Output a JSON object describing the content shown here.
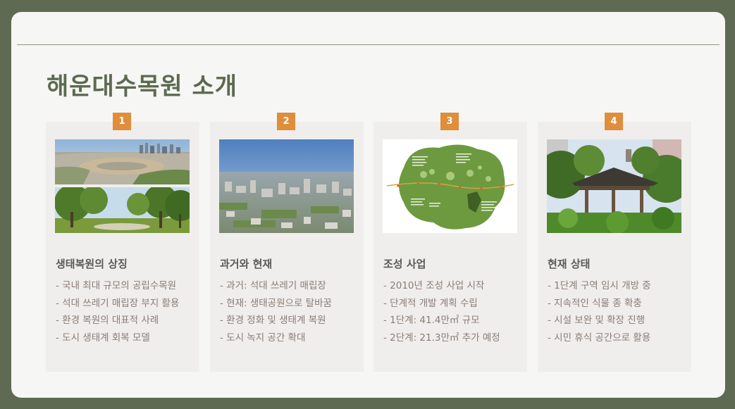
{
  "title": "해운대수목원 소개",
  "cards": [
    {
      "number": "1",
      "heading": "생태복원의 상징",
      "bullets": [
        "- 국내 최대 규모의 공립수목원",
        "- 석대 쓰레기 매립장 부지 활용",
        "- 환경 복원의 대표적 사례",
        "- 도시 생태계 회복 모델"
      ]
    },
    {
      "number": "2",
      "heading": "과거와 현재",
      "bullets": [
        "- 과거: 석대 쓰레기 매립장",
        "- 현재: 생태공원으로 탈바꿈",
        "- 환경 정화 및 생태계 복원",
        "- 도시 녹지 공간 확대"
      ]
    },
    {
      "number": "3",
      "heading": "조성 사업",
      "bullets": [
        "- 2010년 조성 사업 시작",
        "- 단계적 개발 계획 수립",
        "- 1단계: 41.4만㎡ 규모",
        "- 2단계: 21.3만㎡ 추가 예정"
      ]
    },
    {
      "number": "4",
      "heading": "현재 상태",
      "bullets": [
        "- 1단계 구역 임시 개방 중",
        "- 지속적인 식물 종 확충",
        "- 시설 보완 및 확장 진행",
        "- 시민 휴식 공간으로 활용"
      ]
    }
  ]
}
